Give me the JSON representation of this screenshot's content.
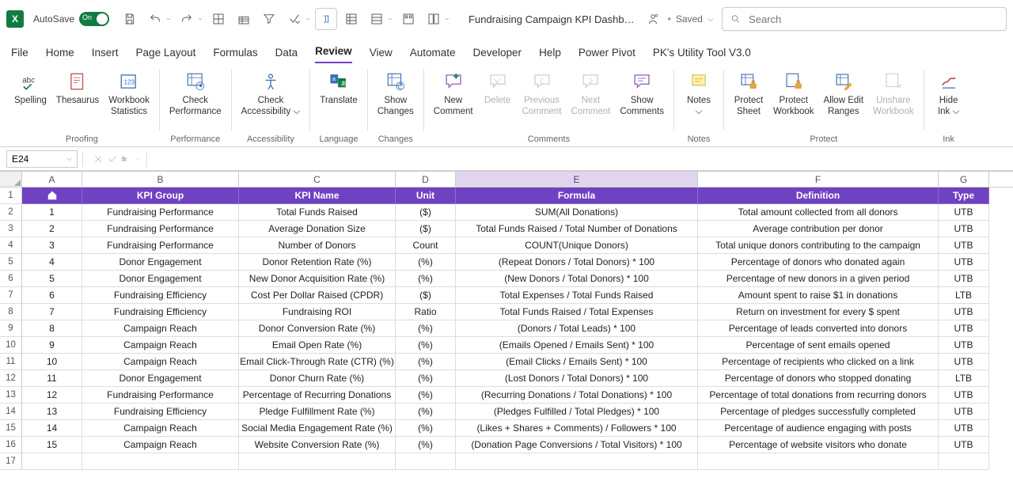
{
  "titlebar": {
    "autosave_label": "AutoSave",
    "autosave_state": "On",
    "doc_title": "Fundraising Campaign KPI Dashb…",
    "saved_label": "Saved",
    "search_placeholder": "Search"
  },
  "tabs": {
    "items": [
      "File",
      "Home",
      "Insert",
      "Page Layout",
      "Formulas",
      "Data",
      "Review",
      "View",
      "Automate",
      "Developer",
      "Help",
      "Power Pivot",
      "PK's Utility Tool V3.0"
    ],
    "active": "Review"
  },
  "ribbon": {
    "proofing": {
      "spelling": "Spelling",
      "thesaurus": "Thesaurus",
      "wbstats": "Workbook\nStatistics",
      "group": "Proofing"
    },
    "performance": {
      "check": "Check\nPerformance",
      "group": "Performance"
    },
    "accessibility": {
      "check": "Check\nAccessibility ⌵",
      "group": "Accessibility"
    },
    "language": {
      "translate": "Translate",
      "group": "Language"
    },
    "changes": {
      "show": "Show\nChanges",
      "group": "Changes"
    },
    "comments": {
      "new": "New\nComment",
      "delete": "Delete",
      "prev": "Previous\nComment",
      "next": "Next\nComment",
      "show": "Show\nComments",
      "group": "Comments"
    },
    "notes": {
      "notes": "Notes\n⌵",
      "group": "Notes"
    },
    "protect": {
      "sheet": "Protect\nSheet",
      "wb": "Protect\nWorkbook",
      "allow": "Allow Edit\nRanges",
      "unshare": "Unshare\nWorkbook",
      "group": "Protect"
    },
    "ink": {
      "hide": "Hide\nInk ⌵",
      "group": "Ink"
    }
  },
  "namebox": "E24",
  "columns": [
    "A",
    "B",
    "C",
    "D",
    "E",
    "F",
    "G"
  ],
  "header_row": [
    "#",
    "KPI Group",
    "KPI Name",
    "Unit",
    "Formula",
    "Definition",
    "Type"
  ],
  "rows": [
    {
      "n": "1",
      "A": "1",
      "B": "Fundraising Performance",
      "C": "Total Funds Raised",
      "D": "($)",
      "E": "SUM(All Donations)",
      "F": "Total amount collected from all donors",
      "G": "UTB"
    },
    {
      "n": "2",
      "A": "2",
      "B": "Fundraising Performance",
      "C": "Average Donation Size",
      "D": "($)",
      "E": "Total Funds Raised / Total Number of Donations",
      "F": "Average contribution per donor",
      "G": "UTB"
    },
    {
      "n": "3",
      "A": "3",
      "B": "Fundraising Performance",
      "C": "Number of Donors",
      "D": "Count",
      "E": "COUNT(Unique Donors)",
      "F": "Total unique donors contributing to the campaign",
      "G": "UTB"
    },
    {
      "n": "4",
      "A": "4",
      "B": "Donor Engagement",
      "C": "Donor Retention Rate (%)",
      "D": "(%)",
      "E": "(Repeat Donors / Total Donors) * 100",
      "F": "Percentage of donors who donated again",
      "G": "UTB"
    },
    {
      "n": "5",
      "A": "5",
      "B": "Donor Engagement",
      "C": "New Donor Acquisition Rate (%)",
      "D": "(%)",
      "E": "(New Donors / Total Donors) * 100",
      "F": "Percentage of new donors in a given period",
      "G": "UTB"
    },
    {
      "n": "6",
      "A": "6",
      "B": "Fundraising Efficiency",
      "C": "Cost Per Dollar Raised (CPDR)",
      "D": "($)",
      "E": "Total Expenses / Total Funds Raised",
      "F": "Amount spent to raise $1 in donations",
      "G": "LTB"
    },
    {
      "n": "7",
      "A": "7",
      "B": "Fundraising Efficiency",
      "C": "Fundraising ROI",
      "D": "Ratio",
      "E": "Total Funds Raised / Total Expenses",
      "F": "Return on investment for every $ spent",
      "G": "UTB"
    },
    {
      "n": "8",
      "A": "8",
      "B": "Campaign Reach",
      "C": "Donor Conversion Rate (%)",
      "D": "(%)",
      "E": "(Donors / Total Leads) * 100",
      "F": "Percentage of leads converted into donors",
      "G": "UTB"
    },
    {
      "n": "9",
      "A": "9",
      "B": "Campaign Reach",
      "C": "Email Open Rate (%)",
      "D": "(%)",
      "E": "(Emails Opened / Emails Sent) * 100",
      "F": "Percentage of sent emails opened",
      "G": "UTB"
    },
    {
      "n": "10",
      "A": "10",
      "B": "Campaign Reach",
      "C": "Email Click-Through Rate (CTR) (%)",
      "D": "(%)",
      "E": "(Email Clicks / Emails Sent) * 100",
      "F": "Percentage of recipients who clicked on a link",
      "G": "UTB"
    },
    {
      "n": "11",
      "A": "11",
      "B": "Donor Engagement",
      "C": "Donor Churn Rate (%)",
      "D": "(%)",
      "E": "(Lost Donors / Total Donors) * 100",
      "F": "Percentage of donors who stopped donating",
      "G": "LTB"
    },
    {
      "n": "12",
      "A": "12",
      "B": "Fundraising Performance",
      "C": "Percentage of Recurring Donations",
      "D": "(%)",
      "E": "(Recurring Donations / Total Donations) * 100",
      "F": "Percentage of total donations from recurring donors",
      "G": "UTB"
    },
    {
      "n": "13",
      "A": "13",
      "B": "Fundraising Efficiency",
      "C": "Pledge Fulfillment Rate (%)",
      "D": "(%)",
      "E": "(Pledges Fulfilled / Total Pledges) * 100",
      "F": "Percentage of pledges successfully completed",
      "G": "UTB"
    },
    {
      "n": "14",
      "A": "14",
      "B": "Campaign Reach",
      "C": "Social Media Engagement Rate (%)",
      "D": "(%)",
      "E": "(Likes + Shares + Comments) / Followers * 100",
      "F": "Percentage of audience engaging with posts",
      "G": "UTB"
    },
    {
      "n": "15",
      "A": "15",
      "B": "Campaign Reach",
      "C": "Website Conversion Rate (%)",
      "D": "(%)",
      "E": "(Donation Page Conversions / Total Visitors) * 100",
      "F": "Percentage of website visitors who donate",
      "G": "UTB"
    }
  ],
  "selected_col": "E",
  "colors": {
    "accent": "#6f42c1",
    "excel_green": "#107c41"
  }
}
